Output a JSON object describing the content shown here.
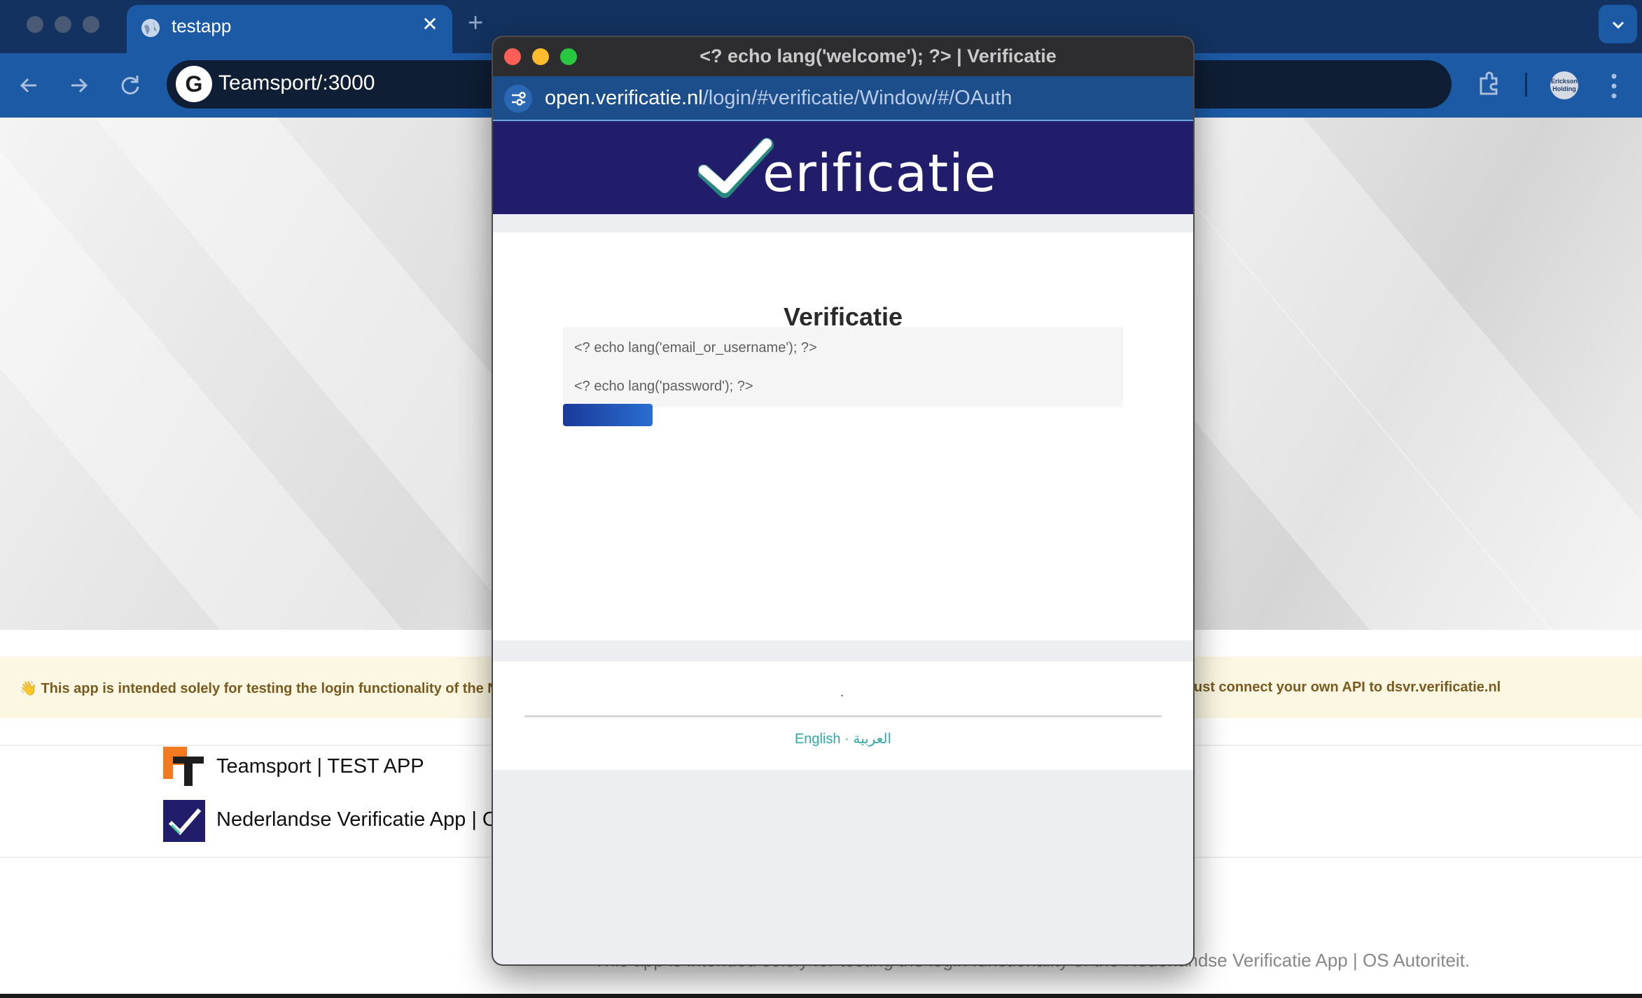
{
  "browser": {
    "tab_title": "testapp",
    "tab_close": "✕",
    "new_tab": "+",
    "address": "Teamsport/:3000",
    "avatar_text": "Erickson Holding",
    "accent_color": "#1c5aa6"
  },
  "page": {
    "banner_left": "👋 This app is intended solely for testing the login functionality of the Ned",
    "banner_right": "ust connect your own API to dsvr.verificatie.nl",
    "apps": [
      {
        "label": "Teamsport | TEST APP",
        "icon": "teamsport-logo"
      },
      {
        "label": "Nederlandse Verificatie App | OS",
        "icon": "verificatie-check-logo"
      }
    ],
    "footer_note": "This app is intended solely for testing the login functionality of the Nederlandse Verificatie App | OS Autoriteit."
  },
  "popup": {
    "window_title": "<? echo lang('welcome'); ?> | Verificatie",
    "url_domain": "open.verificatie.nl",
    "url_path": "/login/#verificatie/Window/#/OAuth",
    "brand_word": "erificatie",
    "heading": "Verificatie",
    "email_placeholder": "<? echo lang('email_or_username'); ?>",
    "password_placeholder": "<? echo lang('password'); ?>",
    "lang_english": "English",
    "lang_separator": "·",
    "lang_arabic": "العربية",
    "header_color": "#221d6b",
    "link_color": "#2fa7a5"
  }
}
